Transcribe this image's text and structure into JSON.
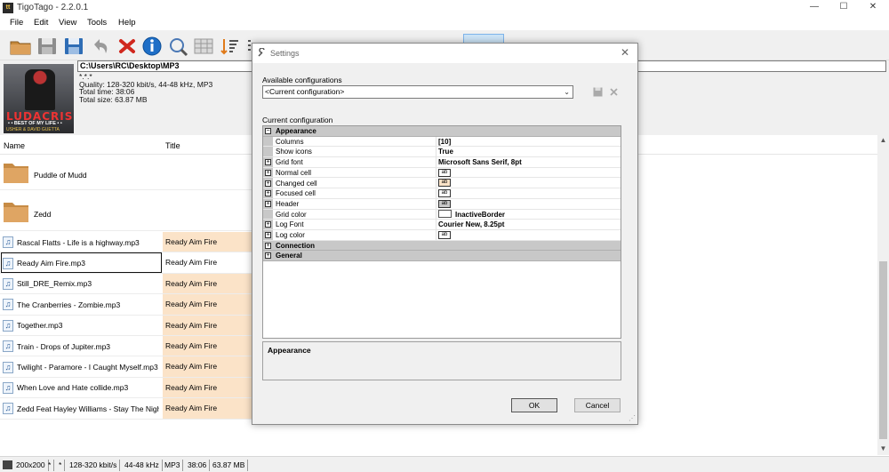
{
  "window": {
    "title": "TigoTago - 2.2.0.1",
    "app_icon_text": "tt",
    "controls": {
      "minimize": "—",
      "maximize": "☐",
      "close": "✕"
    }
  },
  "menu": [
    "File",
    "Edit",
    "View",
    "Tools",
    "Help"
  ],
  "toolbar": {
    "icons": [
      "open-folder-icon",
      "save-disk-icon",
      "save-as-disk-icon",
      "undo-icon",
      "cancel-x-icon",
      "info-icon",
      "edit-tags-icon",
      "grid-view-icon",
      "sort-icon",
      "list-icon",
      "web-icon",
      "columns-icon",
      "rows-icon",
      "search-icon",
      "replace-icon",
      "folder-icon",
      "tools-icon",
      "settings-icon"
    ]
  },
  "info_panel": {
    "path": "C:\\Users\\RC\\Desktop\\MP3",
    "wildcard": "*.*.*",
    "quality": "Quality: 128-320 kbit/s, 44-48 kHz, MP3",
    "total_time": "Total time: 38:06",
    "total_size": "Total size: 63.87 MB",
    "cover": {
      "brand": "LUDACRIS",
      "line1": "• • BEST OF MY LIFE • •",
      "line2": "USHER & DAVID GUETTA"
    }
  },
  "grid": {
    "columns": {
      "name": "Name",
      "title": "Title"
    },
    "folders": [
      "Puddle of Mudd",
      "Zedd"
    ],
    "files": [
      {
        "name": "Rascal Flatts - Life is a highway.mp3",
        "title": "Ready Aim Fire",
        "selected": false
      },
      {
        "name": "Ready Aim Fire.mp3",
        "title": "Ready Aim Fire",
        "selected": true
      },
      {
        "name": "Still_DRE_Remix.mp3",
        "title": "Ready Aim Fire",
        "selected": false
      },
      {
        "name": "The Cranberries - Zombie.mp3",
        "title": "Ready Aim Fire",
        "selected": false
      },
      {
        "name": "Together.mp3",
        "title": "Ready Aim Fire",
        "selected": false
      },
      {
        "name": "Train - Drops of Jupiter.mp3",
        "title": "Ready Aim Fire",
        "selected": false
      },
      {
        "name": "Twilight - Paramore - I Caught Myself.mp3",
        "title": "Ready Aim Fire",
        "selected": false
      },
      {
        "name": "When Love and Hate collide.mp3",
        "title": "Ready Aim Fire",
        "selected": false
      },
      {
        "name": "Zedd Feat Hayley Williams - Stay The Night...",
        "title": "Ready Aim Fire",
        "selected": false
      }
    ],
    "highlight_color": "#fbe3c8"
  },
  "statusbar": {
    "dimensions": "200x200",
    "f1": "*",
    "f2": "*",
    "bitrate": "128-320 kbit/s",
    "samplerate": "44-48 kHz",
    "format": "MP3",
    "duration": "38:06",
    "size": "63.87 MB"
  },
  "settings": {
    "title": "Settings",
    "close": "✕",
    "available_label": "Available configurations",
    "combo_value": "<Current configuration>",
    "current_label": "Current configuration",
    "categories": [
      {
        "name": "Appearance",
        "expanded": true,
        "props": [
          {
            "key": "Columns",
            "value": "[10]",
            "expander": false,
            "kind": "text"
          },
          {
            "key": "Show icons",
            "value": "True",
            "expander": false,
            "kind": "text"
          },
          {
            "key": "Grid font",
            "value": "Microsoft Sans Serif, 8pt",
            "expander": true,
            "kind": "text"
          },
          {
            "key": "Normal cell",
            "value": "ab",
            "expander": true,
            "kind": "sample-white"
          },
          {
            "key": "Changed cell",
            "value": "ab",
            "expander": true,
            "kind": "sample-orange"
          },
          {
            "key": "Focused cell",
            "value": "ab",
            "expander": true,
            "kind": "sample-white"
          },
          {
            "key": "Header",
            "value": "ab",
            "expander": true,
            "kind": "sample-grey"
          },
          {
            "key": "Grid color",
            "value": "InactiveBorder",
            "expander": false,
            "kind": "color"
          },
          {
            "key": "Log Font",
            "value": "Courier New, 8.25pt",
            "expander": true,
            "kind": "text"
          },
          {
            "key": "Log color",
            "value": "ab",
            "expander": true,
            "kind": "sample-white"
          }
        ]
      },
      {
        "name": "Connection",
        "expanded": false,
        "props": []
      },
      {
        "name": "General",
        "expanded": false,
        "props": []
      }
    ],
    "description": "Appearance",
    "ok_label": "OK",
    "cancel_label": "Cancel"
  }
}
